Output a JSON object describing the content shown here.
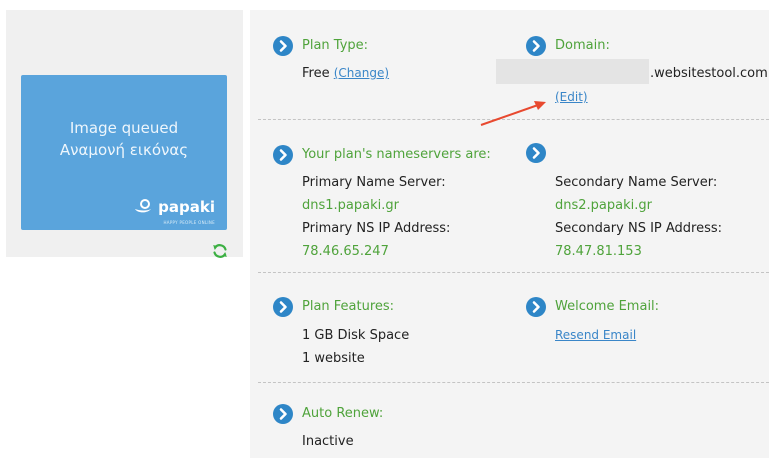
{
  "thumbnail": {
    "line1": "Image queued",
    "line2": "Αναμονή εικόνας",
    "logo": "papaki",
    "tagline": "HAPPY PEOPLE ONLINE",
    "refresh_icon": "refresh-icon"
  },
  "plan": {
    "label": "Plan Type:",
    "value": "Free",
    "change_link": "(Change)"
  },
  "domain": {
    "label": "Domain:",
    "suffix": ".websitestool.com",
    "edit_link": "(Edit)"
  },
  "nameservers": {
    "label": "Your plan's nameservers are:",
    "primary_label": "Primary Name Server:",
    "primary_value": "dns1.papaki.gr",
    "primary_ip_label": "Primary NS IP Address:",
    "primary_ip_value": "78.46.65.247",
    "secondary_label": "Secondary Name Server:",
    "secondary_value": "dns2.papaki.gr",
    "secondary_ip_label": "Secondary NS IP Address:",
    "secondary_ip_value": "78.47.81.153"
  },
  "features": {
    "label": "Plan Features:",
    "item1": "1 GB Disk Space",
    "item2": "1 website"
  },
  "welcome": {
    "label": "Welcome Email:",
    "resend_link": "Resend Email"
  },
  "renew": {
    "label": "Auto Renew:",
    "value": "Inactive"
  },
  "colors": {
    "accent_green": "#4fa33b",
    "link_blue": "#3a86c8",
    "icon_blue": "#2e86c7",
    "thumb_blue": "#5aa4dc",
    "arrow_red": "#e8492f"
  }
}
